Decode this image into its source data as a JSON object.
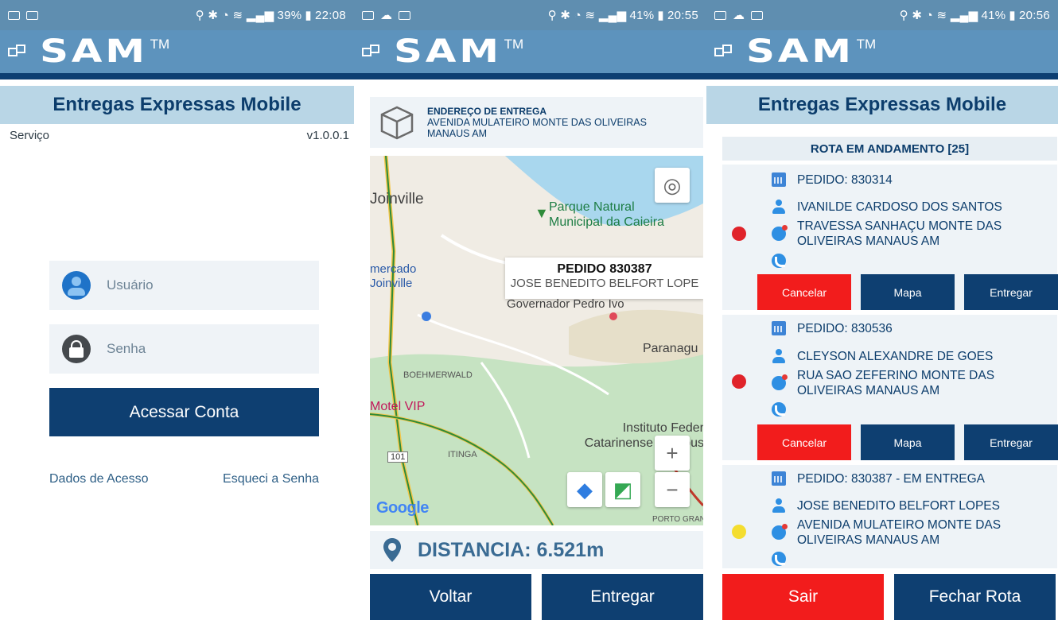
{
  "screens": [
    {
      "status": {
        "time": "22:08",
        "battery": "39%"
      },
      "brand": {
        "name": "SAM",
        "tm": "TM"
      },
      "banner": "Entregas Expressas Mobile",
      "service_label": "Serviço",
      "version": "v1.0.0.1",
      "login": {
        "user_placeholder": "Usuário",
        "password_placeholder": "Senha",
        "submit_label": "Acessar Conta",
        "access_data_link": "Dados de Acesso",
        "forgot_link": "Esqueci a Senha"
      }
    },
    {
      "status": {
        "time": "20:55",
        "battery": "41%"
      },
      "brand": {
        "name": "SAM",
        "tm": "TM"
      },
      "address_box": {
        "title": "ENDEREÇO DE ENTREGA",
        "address": "AVENIDA MULATEIRO MONTE DAS OLIVEIRAS MANAUS AM"
      },
      "map": {
        "labels": {
          "joinville": "Joinville",
          "park": "Parque Natural Municipal da Caieira",
          "mercado": "mercado Joinville",
          "paranagua": "Paranagu",
          "boehmerwald": "BOEHMERWALD",
          "motel": "Motel VIP",
          "instituto": "Instituto Feder Catarinense Campus",
          "itinga": "ITINGA",
          "road": "101",
          "porto": "PORTO GRAN",
          "governador": "Governador Pedro Ivo",
          "google": "Google"
        },
        "info_window": {
          "title": "PEDIDO 830387",
          "subtitle": "JOSE BENEDITO BELFORT LOPE"
        }
      },
      "distance": "DISTANCIA: 6.521m",
      "buttons": {
        "back": "Voltar",
        "deliver": "Entregar"
      }
    },
    {
      "status": {
        "time": "20:56",
        "battery": "41%"
      },
      "brand": {
        "name": "SAM",
        "tm": "TM"
      },
      "banner": "Entregas Expressas Mobile",
      "route_title": "ROTA EM ANDAMENTO [25]",
      "orders": [
        {
          "order": "PEDIDO: 830314",
          "customer": "IVANILDE CARDOSO DOS SANTOS",
          "address": "TRAVESSA SANHAÇU MONTE DAS OLIVEIRAS MANAUS AM",
          "status_color": "#e0232a"
        },
        {
          "order": "PEDIDO: 830536",
          "customer": "CLEYSON ALEXANDRE DE GOES",
          "address": "RUA SAO ZEFERINO MONTE DAS OLIVEIRAS MANAUS AM",
          "status_color": "#e0232a"
        },
        {
          "order": "PEDIDO: 830387 - EM ENTREGA",
          "customer": "JOSE BENEDITO BELFORT LOPES",
          "address": "AVENIDA MULATEIRO MONTE DAS OLIVEIRAS MANAUS AM",
          "status_color": "#f4dd2f"
        }
      ],
      "order_buttons": {
        "cancel": "Cancelar",
        "map": "Mapa",
        "deliver": "Entregar"
      },
      "footer": {
        "exit": "Sair",
        "close_route": "Fechar Rota"
      }
    }
  ],
  "colors": {
    "header": "#5d93bd",
    "navy": "#0e3f71",
    "banner": "#b9d6e6",
    "danger": "#f21c1c"
  }
}
